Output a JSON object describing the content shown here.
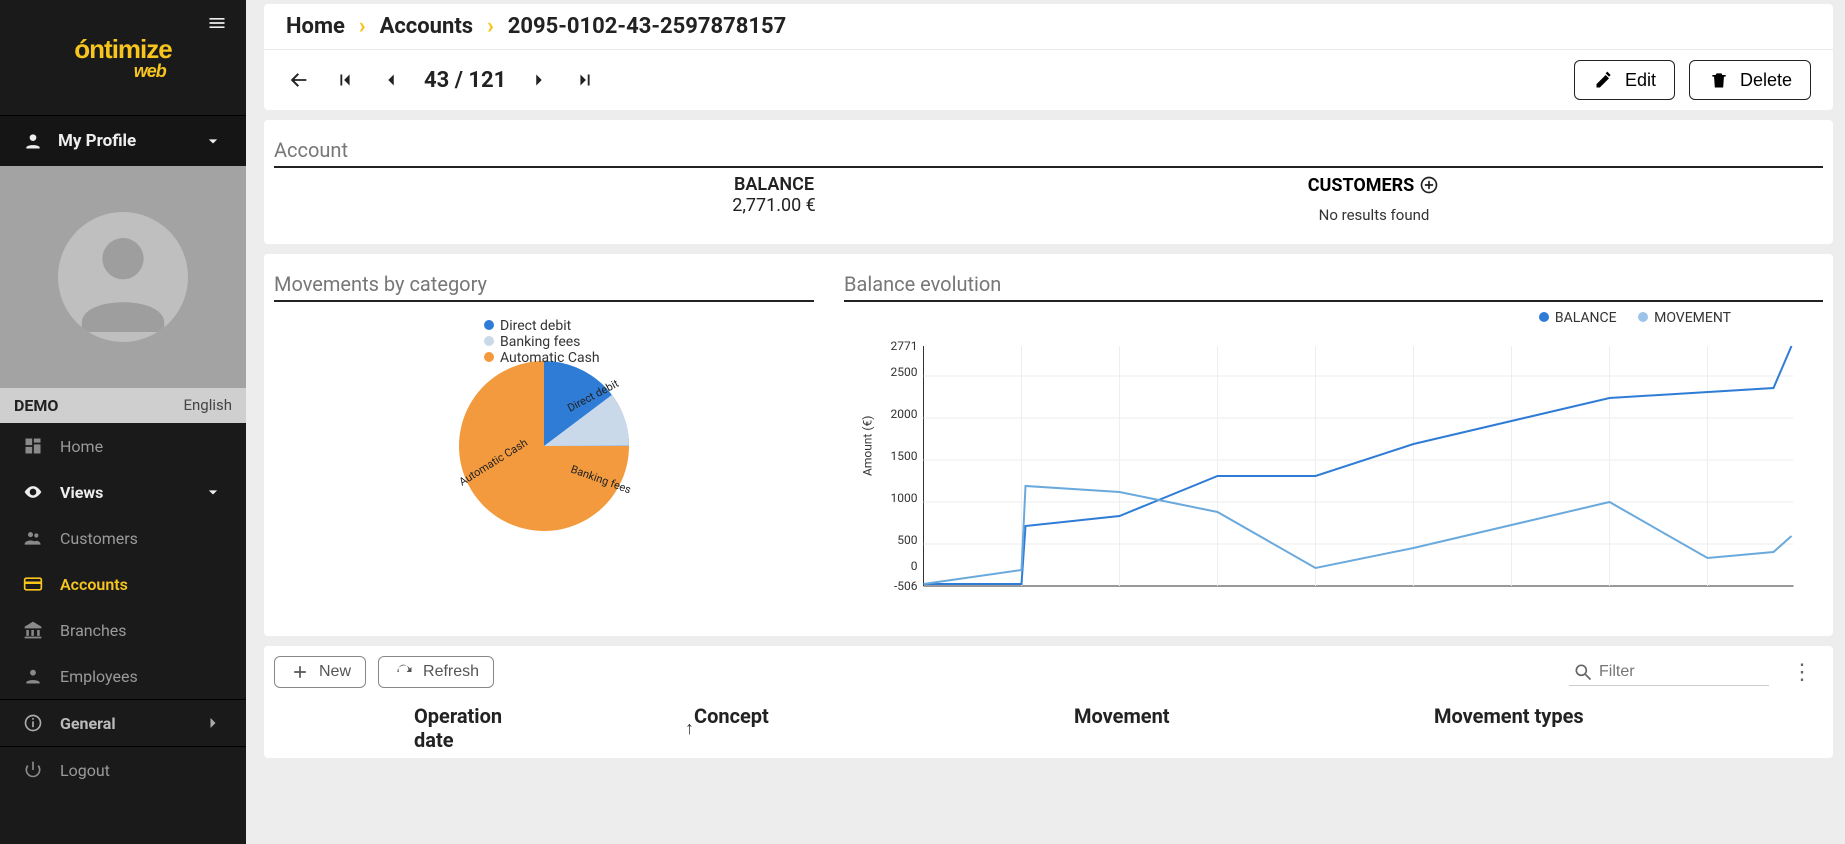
{
  "sidebar": {
    "brand_top": "óntimize",
    "brand_sub": "web",
    "my_profile": "My Profile",
    "user": "DEMO",
    "language": "English",
    "home": "Home",
    "views": "Views",
    "items": {
      "customers": "Customers",
      "accounts": "Accounts",
      "branches": "Branches",
      "employees": "Employees"
    },
    "general": "General",
    "logout": "Logout"
  },
  "breadcrumb": {
    "home": "Home",
    "accounts": "Accounts",
    "id": "2095-0102-43-2597878157"
  },
  "pager": {
    "pos": "43",
    "total": "121",
    "sep": " / "
  },
  "actions": {
    "edit": "Edit",
    "delete": "Delete"
  },
  "account_panel": {
    "title": "Account",
    "balance_label": "BALANCE",
    "balance_value": "2,771.00 €",
    "customers_label": "CUSTOMERS",
    "customers_msg": "No results found"
  },
  "charts": {
    "left_title": "Movements by category",
    "right_title": "Balance evolution",
    "pie_legend": [
      "Direct debit",
      "Banking fees",
      "Automatic Cash"
    ],
    "line_legend": [
      "BALANCE",
      "MOVEMENT"
    ],
    "y_axis_label": "Amount (€)"
  },
  "table": {
    "new": "New",
    "refresh": "Refresh",
    "filter_placeholder": "Filter",
    "cols": {
      "opdate": "Operation date",
      "concept": "Concept",
      "movement": "Movement",
      "mtypes": "Movement types"
    }
  },
  "chart_data": [
    {
      "type": "pie",
      "title": "Movements by category",
      "series": [
        {
          "name": "Direct debit",
          "value": 25,
          "color": "#2e7cd6"
        },
        {
          "name": "Banking fees",
          "value": 10,
          "color": "#c9d9ea"
        },
        {
          "name": "Automatic Cash",
          "value": 65,
          "color": "#f39a3e"
        }
      ]
    },
    {
      "type": "line",
      "title": "Balance evolution",
      "ylabel": "Amount (€)",
      "ylim": [
        -506,
        2771
      ],
      "yticks": [
        -506,
        0,
        500,
        1000,
        1500,
        2000,
        2500,
        2771
      ],
      "x": [
        0,
        1,
        2,
        3,
        4,
        5,
        6,
        7,
        8,
        9
      ],
      "series": [
        {
          "name": "BALANCE",
          "color": "#2e7cd6",
          "values": [
            -380,
            -380,
            460,
            700,
            1120,
            1120,
            1600,
            2080,
            2250,
            2771
          ]
        },
        {
          "name": "MOVEMENT",
          "color": "#9cc3e8",
          "values": [
            -380,
            -60,
            930,
            870,
            700,
            20,
            300,
            600,
            960,
            170
          ]
        }
      ]
    }
  ]
}
